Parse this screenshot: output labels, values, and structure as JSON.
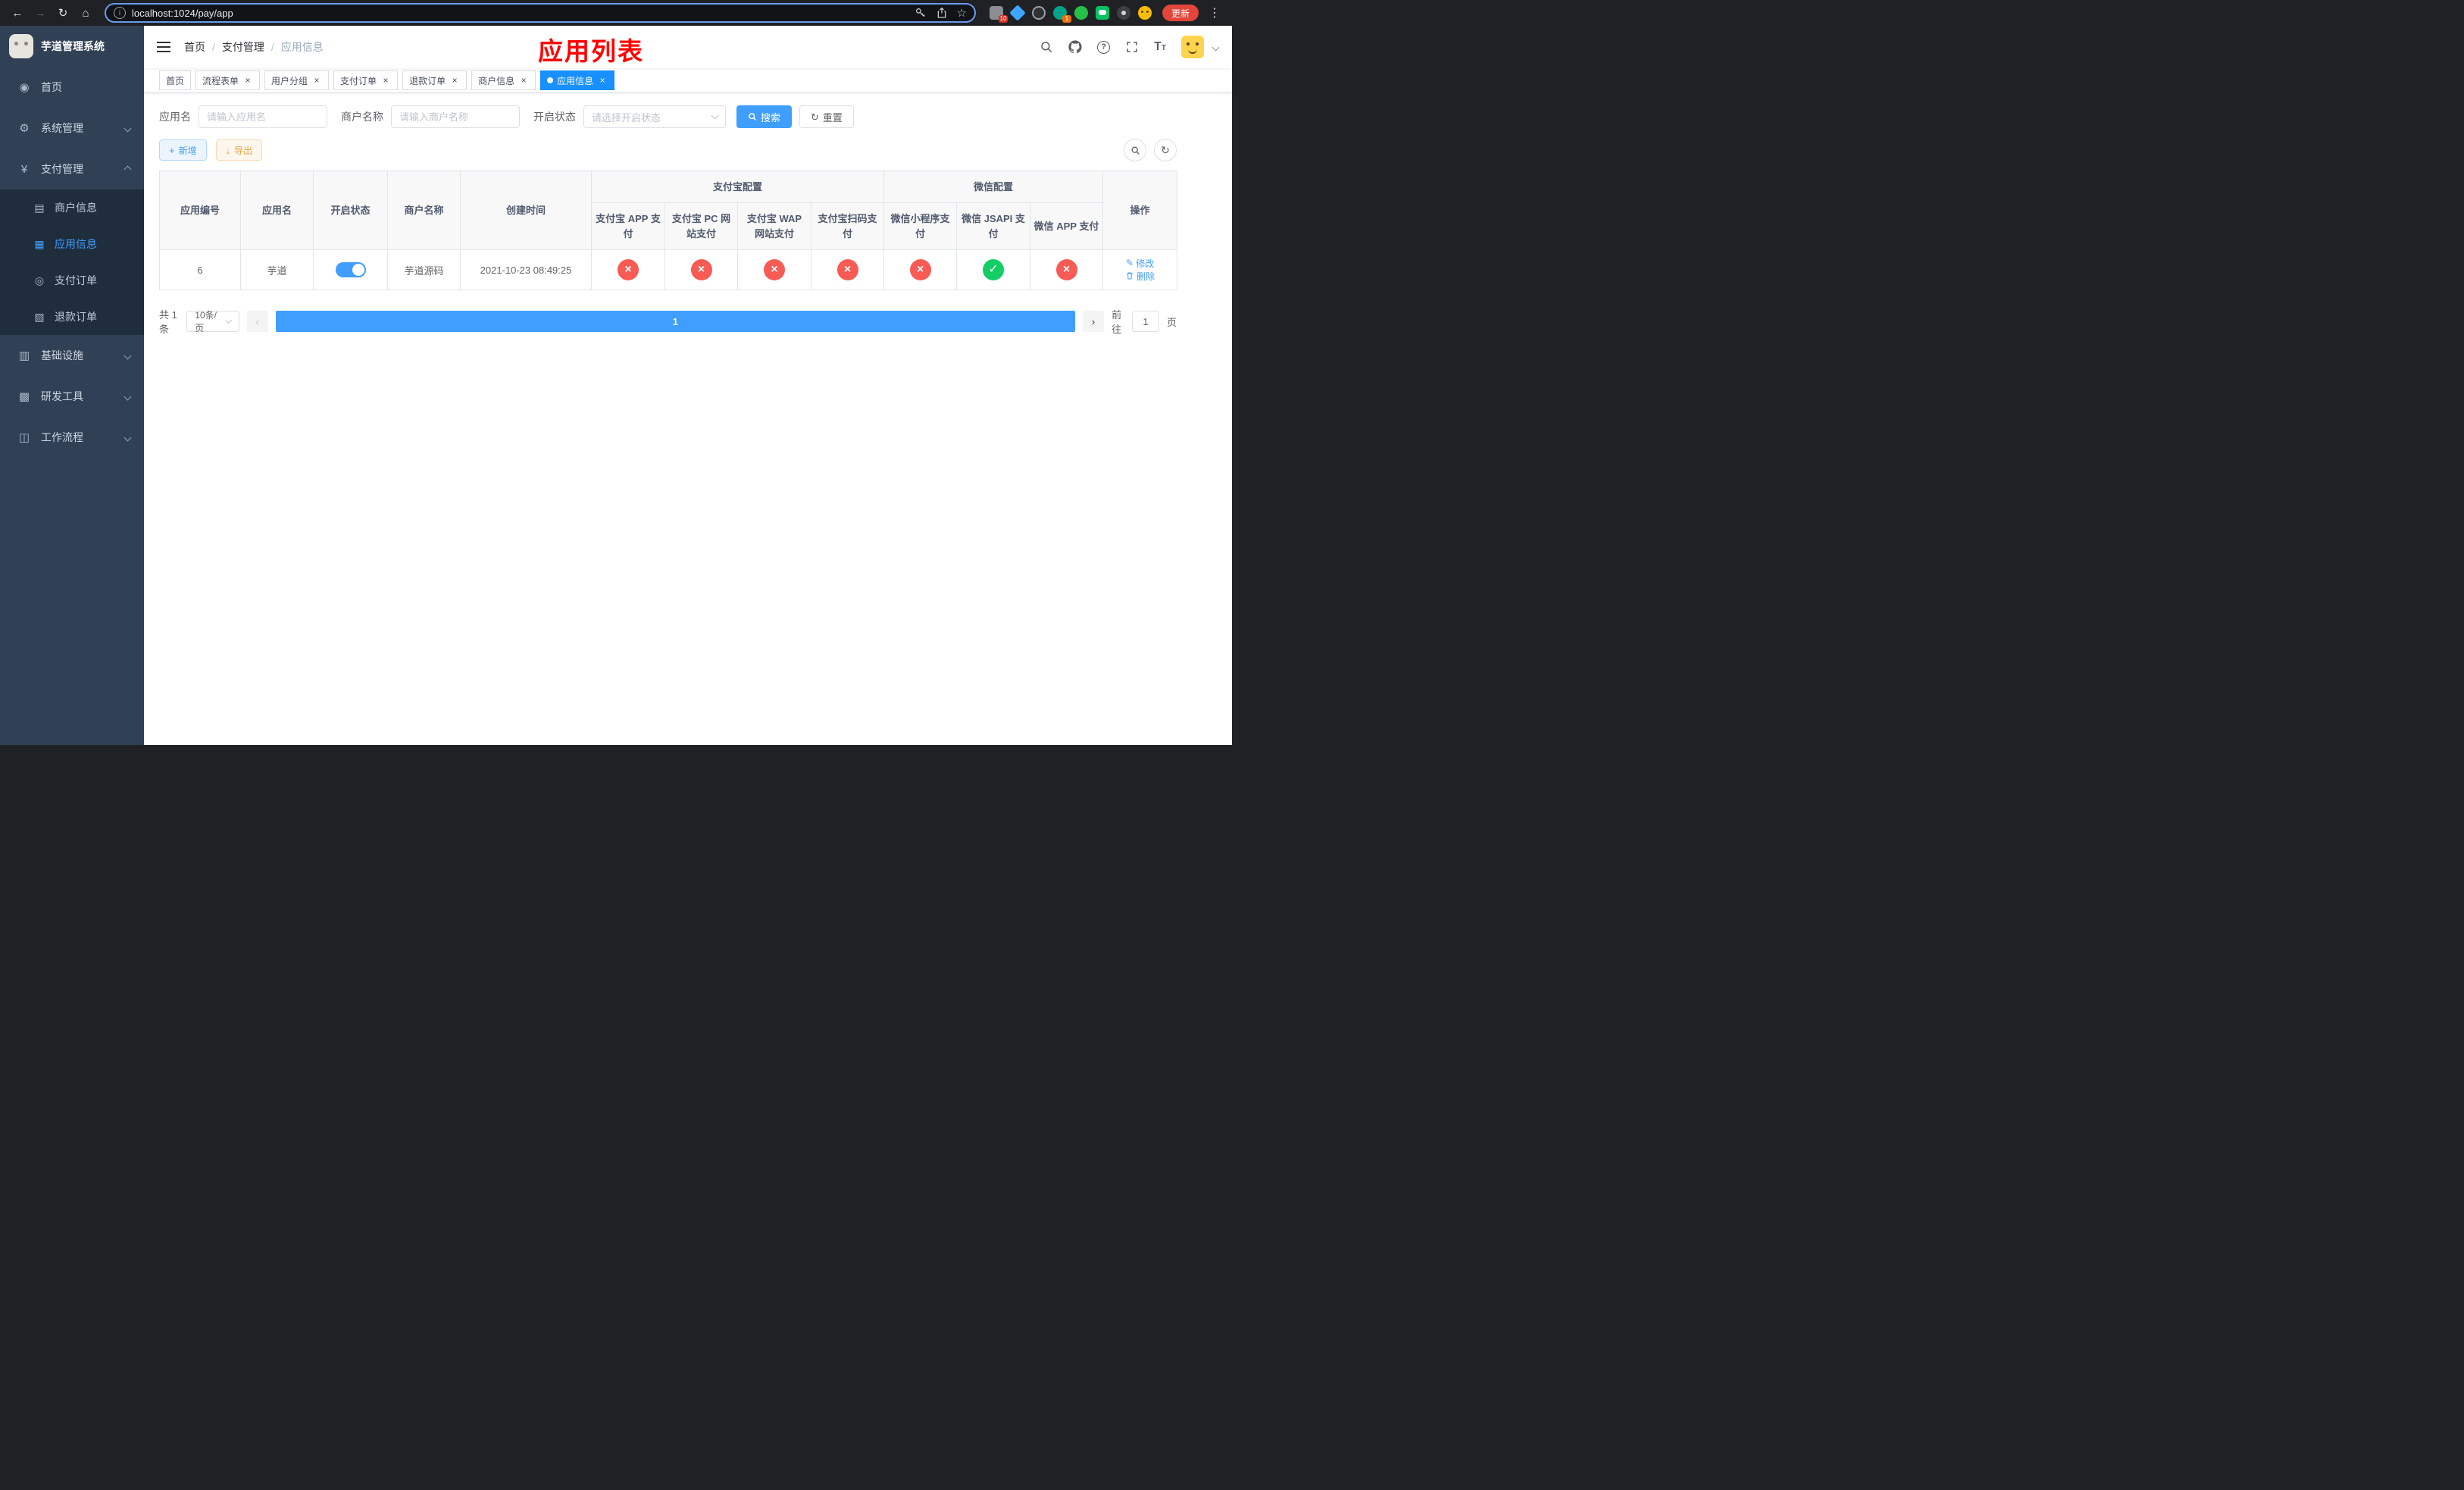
{
  "browser": {
    "url": "localhost:1024/pay/app",
    "update_label": "更新",
    "ext_badge_puzzle": "10",
    "ext_badge_green": "1"
  },
  "icons": {
    "back": "←",
    "forward": "→",
    "reload": "↻",
    "home": "⌂",
    "info": "i",
    "bookmark": "☆",
    "more": "⋮",
    "close": "×",
    "check": "✓",
    "cross": "×",
    "dashboard": "◉",
    "gear": "⚙",
    "yen": "¥",
    "merchant": "▤",
    "app": "▦",
    "order": "◎",
    "refund": "▧",
    "infra": "▥",
    "devtool": "▩",
    "workflow": "◫",
    "plus": "+",
    "download": "↓",
    "refresh": "↻",
    "edit": "✎",
    "prev": "‹",
    "next": "›",
    "help": "?",
    "text_big": "T",
    "text_small": "T"
  },
  "sidebar": {
    "title": "芋道管理系统",
    "items": [
      {
        "label": "首页"
      },
      {
        "label": "系统管理"
      },
      {
        "label": "支付管理"
      },
      {
        "label": "基础设施"
      },
      {
        "label": "研发工具"
      },
      {
        "label": "工作流程"
      }
    ],
    "payment_children": [
      {
        "label": "商户信息"
      },
      {
        "label": "应用信息"
      },
      {
        "label": "支付订单"
      },
      {
        "label": "退款订单"
      }
    ]
  },
  "header": {
    "breadcrumb": [
      "首页",
      "支付管理",
      "应用信息"
    ],
    "separator": "/",
    "annotation": "应用列表"
  },
  "tabs": [
    {
      "label": "首页",
      "closable": false
    },
    {
      "label": "流程表单",
      "closable": true
    },
    {
      "label": "用户分组",
      "closable": true
    },
    {
      "label": "支付订单",
      "closable": true
    },
    {
      "label": "退款订单",
      "closable": true
    },
    {
      "label": "商户信息",
      "closable": true
    },
    {
      "label": "应用信息",
      "closable": true,
      "active": true
    }
  ],
  "filters": {
    "app_name_label": "应用名",
    "app_name_placeholder": "请输入应用名",
    "merchant_label": "商户名称",
    "merchant_placeholder": "请输入商户名称",
    "status_label": "开启状态",
    "status_placeholder": "请选择开启状态",
    "search_label": "搜索",
    "reset_label": "重置"
  },
  "toolbar": {
    "add_label": "新增",
    "export_label": "导出"
  },
  "table": {
    "simple_columns": [
      "应用编号",
      "应用名",
      "开启状态",
      "商户名称",
      "创建时间"
    ],
    "alipay_group": "支付宝配置",
    "alipay_columns": [
      "支付宝 APP 支付",
      "支付宝 PC 网站支付",
      "支付宝 WAP 网站支付",
      "支付宝扫码支付"
    ],
    "wechat_group": "微信配置",
    "wechat_columns": [
      "微信小程序支付",
      "微信 JSAPI 支付",
      "微信 APP 支付"
    ],
    "actions_column": "操作",
    "rows": [
      {
        "id": "6",
        "name": "芋道",
        "enabled": true,
        "merchant": "芋道源码",
        "created": "2021-10-23 08:49:25",
        "configs": [
          false,
          false,
          false,
          false,
          false,
          true,
          false
        ],
        "edit_label": "修改",
        "delete_label": "删除"
      }
    ]
  },
  "pagination": {
    "total": "共 1 条",
    "page_size": "10条/页",
    "current_page": "1",
    "goto_label": "前往",
    "goto_value": "1",
    "page_unit": "页"
  },
  "colors": {
    "accent": "#409eff",
    "tab_active": "#1890ff",
    "danger": "#f85a54",
    "success": "#13ce66",
    "warning": "#e6a23c",
    "annotation": "#ff0000",
    "sidebar_bg": "#304156",
    "submenu_bg": "#1f2d3d"
  }
}
